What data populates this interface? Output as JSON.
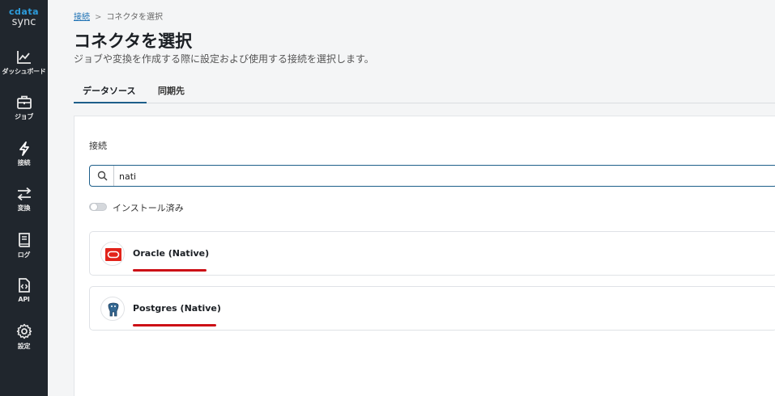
{
  "sidebar": {
    "logo_brand": "cdata",
    "logo_product": "sync",
    "items": [
      {
        "label": "ダッシュボード",
        "icon": "chart-line-icon"
      },
      {
        "label": "ジョブ",
        "icon": "briefcase-icon"
      },
      {
        "label": "接続",
        "icon": "lightning-bolt-icon"
      },
      {
        "label": "変換",
        "icon": "swap-arrows-icon"
      },
      {
        "label": "ログ",
        "icon": "log-book-icon"
      },
      {
        "label": "API",
        "icon": "api-file-icon"
      },
      {
        "label": "設定",
        "icon": "gear-icon"
      }
    ]
  },
  "breadcrumb": {
    "link": "接続",
    "separator": ">",
    "current": "コネクタを選択"
  },
  "page": {
    "title": "コネクタを選択",
    "subtitle": "ジョブや変換を作成する際に設定および使用する接続を選択します。"
  },
  "tabs": [
    {
      "label": "データソース",
      "active": true
    },
    {
      "label": "同期先",
      "active": false
    }
  ],
  "panel": {
    "section_label": "接続",
    "search": {
      "value": "nati",
      "placeholder": ""
    },
    "installed_toggle": {
      "label": "インストール済み",
      "checked": false
    }
  },
  "connectors": [
    {
      "name": "Oracle (Native)",
      "icon": "oracle-logo-icon",
      "brand_color": "#e2231a"
    },
    {
      "name": "Postgres (Native)",
      "icon": "postgres-elephant-icon",
      "brand_color": "#336791"
    }
  ],
  "colors": {
    "sidebar_bg": "#20262d",
    "accent": "#1d5f8a",
    "annotation_red": "#cc1016"
  }
}
